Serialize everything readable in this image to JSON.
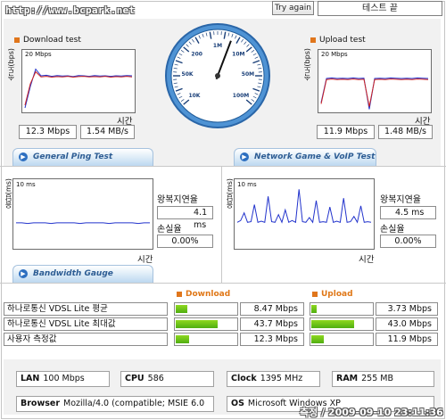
{
  "header": {
    "url": "http://www.bcpark.net",
    "try_again_label": "Try again",
    "status_label": "테스트 끝"
  },
  "download": {
    "title": "Download test",
    "y_axis_label": "속도(bps)",
    "y_max_label": "20 Mbps",
    "x_axis_label": "시간",
    "speed_mbps": "12.3 Mbps",
    "speed_mbs": "1.54 MB/s",
    "chart_data": {
      "type": "line",
      "ymax": 20,
      "series": [
        {
          "color": "#2233cc",
          "values": [
            1,
            9,
            15.5,
            13,
            13.2,
            12.8,
            13.1,
            12.9,
            13,
            12.7,
            13.1,
            13,
            12.8,
            13.1,
            12.9,
            13,
            12.8,
            13,
            12.9,
            13.1,
            13
          ]
        },
        {
          "color": "#cc2222",
          "values": [
            2,
            10,
            14.5,
            12.6,
            12.8,
            12.5,
            12.7,
            12.6,
            12.8,
            12.5,
            12.7,
            12.8,
            12.6,
            12.7,
            12.6,
            12.8,
            12.5,
            12.7,
            12.6,
            12.8,
            12.6
          ]
        }
      ]
    }
  },
  "upload": {
    "title": "Upload test",
    "y_axis_label": "속도(bps)",
    "y_max_label": "20 Mbps",
    "x_axis_label": "시간",
    "speed_mbps": "11.9 Mbps",
    "speed_mbs": "1.48 MB/s",
    "chart_data": {
      "type": "line",
      "ymax": 20,
      "series": [
        {
          "color": "#2233cc",
          "values": [
            3,
            12,
            12.2,
            12,
            12.1,
            12,
            12.2,
            12,
            12.1,
            0.5,
            12,
            12.1,
            12,
            12.2,
            12.1,
            12,
            12.1,
            12,
            12.2,
            12.1,
            12
          ]
        },
        {
          "color": "#cc2222",
          "values": [
            2.5,
            11.6,
            11.8,
            11.6,
            11.7,
            11.6,
            11.8,
            11.6,
            11.7,
            1.5,
            11.6,
            11.7,
            11.6,
            11.8,
            11.7,
            11.6,
            11.7,
            11.6,
            11.8,
            11.7,
            11.6
          ]
        }
      ]
    }
  },
  "gauge": {
    "ticks": [
      "10K",
      "50K",
      "200",
      "1M",
      "10M",
      "50M",
      "100M"
    ],
    "needle_fraction": 0.58
  },
  "ping": {
    "tab_label": "General Ping Test",
    "y_axis_label": "응답(ms)",
    "y_max_label": "10 ms",
    "x_axis_label": "시간",
    "latency_label": "왕복지연율",
    "latency_value": "4.1 ms",
    "loss_label": "손실율",
    "loss_value": "0.00%",
    "chart_data": {
      "type": "line",
      "ymax": 10,
      "values": [
        4.1,
        4.1,
        4.0,
        4.1,
        4.1,
        4.1,
        4.0,
        4.1,
        4.1,
        4.1,
        4.1,
        4.0,
        4.1,
        4.1,
        4.1,
        4.1,
        4.0,
        4.1,
        4.1,
        4.1,
        4.1,
        4.0,
        4.1,
        4.1
      ]
    }
  },
  "game": {
    "tab_label": "Network Game & VoIP Test",
    "y_axis_label": "응답(ms)",
    "y_max_label": "10 ms",
    "x_axis_label": "시간",
    "latency_label": "왕복지연율",
    "latency_value": "4.5 ms",
    "loss_label": "손실율",
    "loss_value": "0.00%",
    "chart_data": {
      "type": "line",
      "ymax": 10,
      "values": [
        4.2,
        4.5,
        5.8,
        4.2,
        4.3,
        7.2,
        4.2,
        4.4,
        4.2,
        8.6,
        4.3,
        4.2,
        5.5,
        4.2,
        6.3,
        4.2,
        4.5,
        4.2,
        9.8,
        4.3,
        4.2,
        5.0,
        4.2,
        7.9,
        4.2,
        4.3,
        4.2,
        6.8,
        4.2,
        4.4,
        4.2,
        8.3,
        4.2,
        4.3,
        5.2,
        4.2,
        7.0,
        4.2,
        4.3,
        4.2
      ]
    }
  },
  "bandwidth": {
    "tab_label": "Bandwidth Gauge",
    "download_header": "Download",
    "upload_header": "Upload",
    "rows": [
      {
        "label": "하나로통신 VDSL Lite 평균",
        "download": "8.47 Mbps",
        "download_fraction": 0.19,
        "upload": "3.73 Mbps",
        "upload_fraction": 0.09
      },
      {
        "label": "하나로통신 VDSL Lite 최대값",
        "download": "43.7 Mbps",
        "download_fraction": 0.69,
        "upload": "43.0 Mbps",
        "upload_fraction": 0.7
      },
      {
        "label": "사용자 측정값",
        "download": "12.3 Mbps",
        "download_fraction": 0.22,
        "upload": "11.9 Mbps",
        "upload_fraction": 0.2
      }
    ]
  },
  "system": {
    "lan_label": "LAN",
    "lan_value": "100 Mbps",
    "cpu_label": "CPU",
    "cpu_value": "586",
    "clock_label": "Clock",
    "clock_value": "1395 MHz",
    "ram_label": "RAM",
    "ram_value": "255 MB",
    "browser_label": "Browser",
    "browser_value": "Mozilla/4.0 (compatible; MSIE 6.0",
    "os_label": "OS",
    "os_value": "Microsoft Windows XP"
  },
  "footer": {
    "timestamp": "측정 / 2009-09-10 23:11:36"
  }
}
